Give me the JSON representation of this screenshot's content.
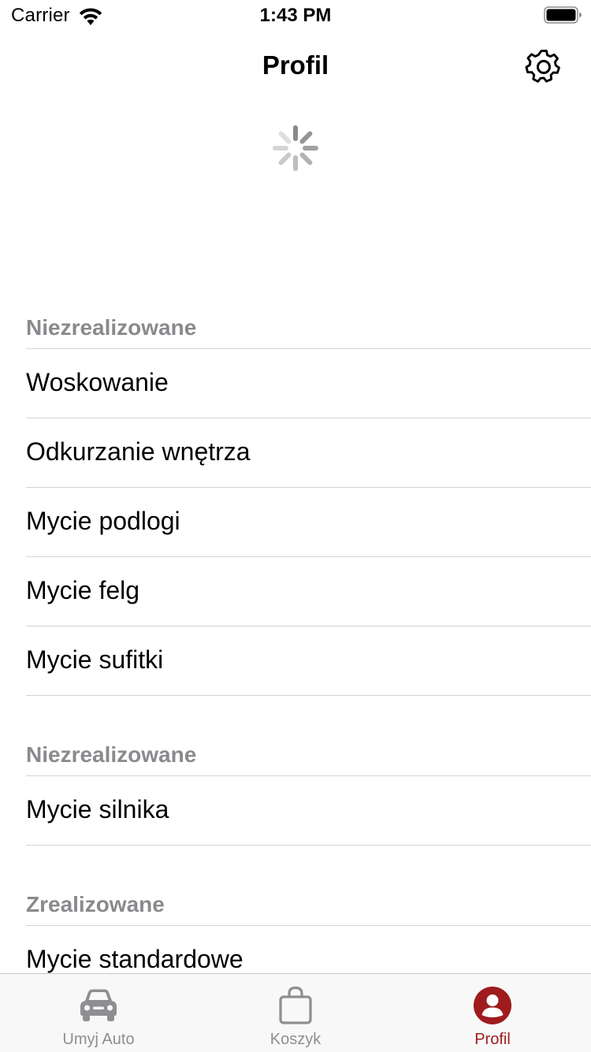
{
  "status_bar": {
    "carrier": "Carrier",
    "time": "1:43 PM"
  },
  "nav": {
    "title": "Profil",
    "settings_icon": "gear-icon"
  },
  "sections": [
    {
      "header": "Niezrealizowane",
      "items": [
        "Woskowanie",
        "Odkurzanie wnętrza",
        "Mycie podlogi",
        "Mycie felg",
        "Mycie sufitki"
      ]
    },
    {
      "header": "Niezrealizowane",
      "items": [
        "Mycie silnika"
      ]
    },
    {
      "header": "Zrealizowane",
      "items": [
        "Mycie standardowe"
      ]
    }
  ],
  "tabs": [
    {
      "label": "Umyj Auto",
      "icon": "car-icon"
    },
    {
      "label": "Koszyk",
      "icon": "bag-icon"
    },
    {
      "label": "Profil",
      "icon": "profile-icon",
      "active": true
    }
  ],
  "colors": {
    "accent": "#9e1b1e",
    "inactive": "#8e8e93",
    "section_header": "#8a8a8e"
  }
}
